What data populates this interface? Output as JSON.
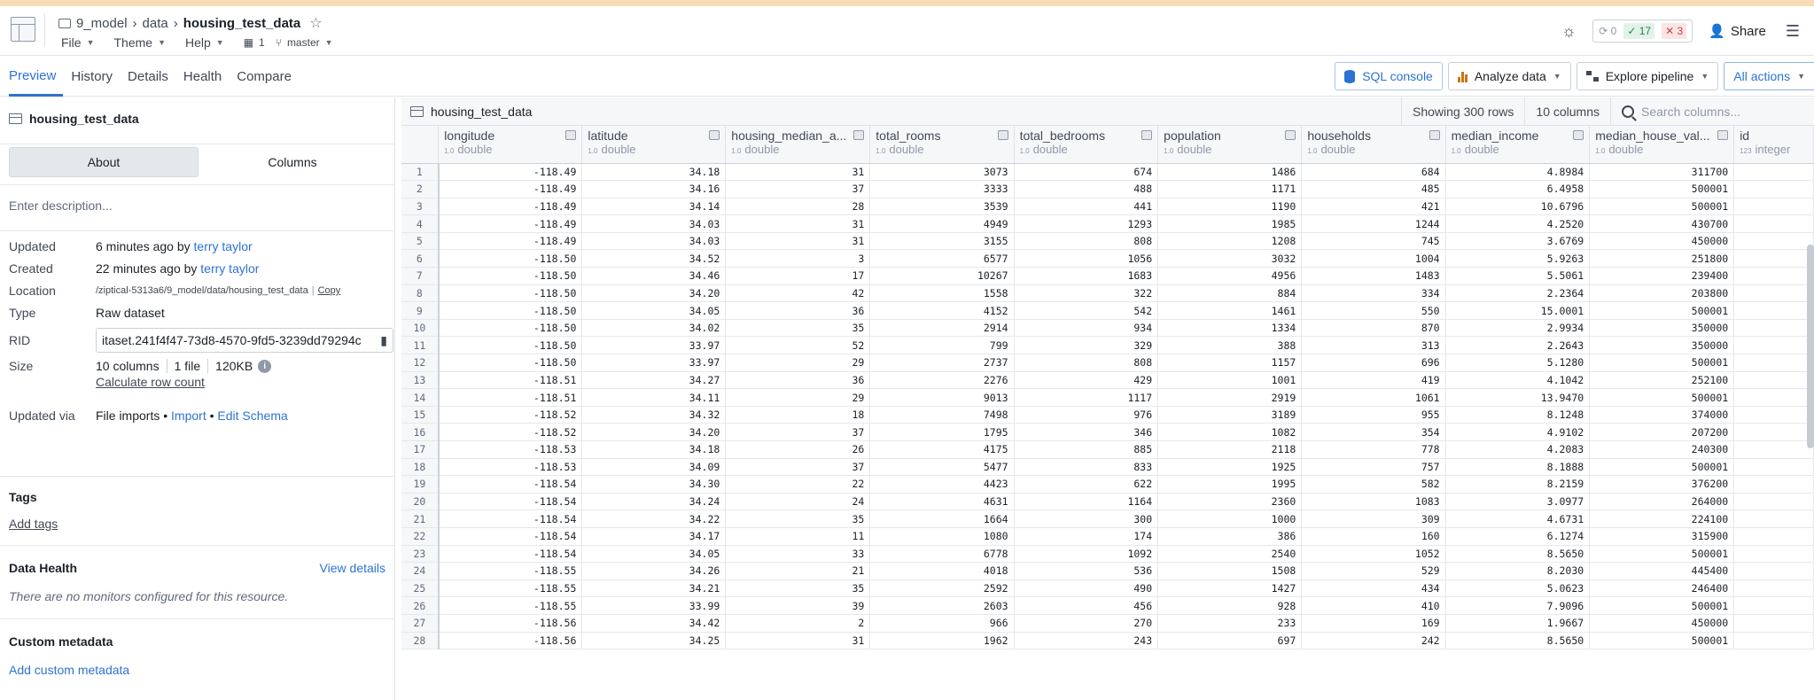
{
  "breadcrumb": {
    "parts": [
      "9_model",
      "data"
    ],
    "current": "housing_test_data"
  },
  "menus": [
    {
      "label": "File"
    },
    {
      "label": "Theme"
    },
    {
      "label": "Help"
    }
  ],
  "header": {
    "branch_count": "1",
    "branch": "master",
    "checks": {
      "pending": "0",
      "passed": "17",
      "failed": "3"
    },
    "share_label": "Share"
  },
  "tabs": [
    "Preview",
    "History",
    "Details",
    "Health",
    "Compare"
  ],
  "actions": {
    "sql": "SQL console",
    "analyze": "Analyze data",
    "explore": "Explore pipeline",
    "all": "All actions"
  },
  "left": {
    "title": "housing_test_data",
    "seg_about": "About",
    "seg_columns": "Columns",
    "description_placeholder": "Enter description...",
    "updated_label": "Updated",
    "updated_time": "6 minutes ago by",
    "updated_user": "terry taylor",
    "created_label": "Created",
    "created_time": "22 minutes ago by",
    "created_user": "terry taylor",
    "location_label": "Location",
    "location_value": "/ziptical-5313a6/9_model/data/housing_test_data",
    "copy_label": "Copy",
    "type_label": "Type",
    "type_value": "Raw dataset",
    "rid_label": "RID",
    "rid_value": "itaset.241f4f47-73d8-4570-9fd5-3239dd79294c",
    "size_label": "Size",
    "size_columns": "10 columns",
    "size_files": "1 file",
    "size_bytes": "120KB",
    "calc_rows": "Calculate row count",
    "updated_via_label": "Updated via",
    "updated_via_value": "File imports",
    "import_link": "Import",
    "edit_schema_link": "Edit Schema",
    "tags_heading": "Tags",
    "add_tags": "Add tags",
    "health_heading": "Data Health",
    "view_details": "View details",
    "health_note": "There are no monitors configured for this resource.",
    "custom_heading": "Custom metadata",
    "add_custom": "Add custom metadata"
  },
  "grid": {
    "name": "housing_test_data",
    "showing": "Showing 300 rows",
    "columns_count": "10 columns",
    "search_placeholder": "Search columns...",
    "columns": [
      {
        "name": "longitude",
        "type": "double"
      },
      {
        "name": "latitude",
        "type": "double"
      },
      {
        "name": "housing_median_a...",
        "type": "double"
      },
      {
        "name": "total_rooms",
        "type": "double"
      },
      {
        "name": "total_bedrooms",
        "type": "double"
      },
      {
        "name": "population",
        "type": "double"
      },
      {
        "name": "households",
        "type": "double"
      },
      {
        "name": "median_income",
        "type": "double"
      },
      {
        "name": "median_house_val...",
        "type": "double"
      },
      {
        "name": "id",
        "type": "integer"
      }
    ],
    "rows": [
      [
        "1",
        "-118.49",
        "34.18",
        "31",
        "3073",
        "674",
        "1486",
        "684",
        "4.8984",
        "311700"
      ],
      [
        "2",
        "-118.49",
        "34.16",
        "37",
        "3333",
        "488",
        "1171",
        "485",
        "6.4958",
        "500001"
      ],
      [
        "3",
        "-118.49",
        "34.14",
        "28",
        "3539",
        "441",
        "1190",
        "421",
        "10.6796",
        "500001"
      ],
      [
        "4",
        "-118.49",
        "34.03",
        "31",
        "4949",
        "1293",
        "1985",
        "1244",
        "4.2520",
        "430700"
      ],
      [
        "5",
        "-118.49",
        "34.03",
        "31",
        "3155",
        "808",
        "1208",
        "745",
        "3.6769",
        "450000"
      ],
      [
        "6",
        "-118.50",
        "34.52",
        "3",
        "6577",
        "1056",
        "3032",
        "1004",
        "5.9263",
        "251800"
      ],
      [
        "7",
        "-118.50",
        "34.46",
        "17",
        "10267",
        "1683",
        "4956",
        "1483",
        "5.5061",
        "239400"
      ],
      [
        "8",
        "-118.50",
        "34.20",
        "42",
        "1558",
        "322",
        "884",
        "334",
        "2.2364",
        "203800"
      ],
      [
        "9",
        "-118.50",
        "34.05",
        "36",
        "4152",
        "542",
        "1461",
        "550",
        "15.0001",
        "500001"
      ],
      [
        "10",
        "-118.50",
        "34.02",
        "35",
        "2914",
        "934",
        "1334",
        "870",
        "2.9934",
        "350000"
      ],
      [
        "11",
        "-118.50",
        "33.97",
        "52",
        "799",
        "329",
        "388",
        "313",
        "2.2643",
        "350000"
      ],
      [
        "12",
        "-118.50",
        "33.97",
        "29",
        "2737",
        "808",
        "1157",
        "696",
        "5.1280",
        "500001"
      ],
      [
        "13",
        "-118.51",
        "34.27",
        "36",
        "2276",
        "429",
        "1001",
        "419",
        "4.1042",
        "252100"
      ],
      [
        "14",
        "-118.51",
        "34.11",
        "29",
        "9013",
        "1117",
        "2919",
        "1061",
        "13.9470",
        "500001"
      ],
      [
        "15",
        "-118.52",
        "34.32",
        "18",
        "7498",
        "976",
        "3189",
        "955",
        "8.1248",
        "374000"
      ],
      [
        "16",
        "-118.52",
        "34.20",
        "37",
        "1795",
        "346",
        "1082",
        "354",
        "4.9102",
        "207200"
      ],
      [
        "17",
        "-118.53",
        "34.18",
        "26",
        "4175",
        "885",
        "2118",
        "778",
        "4.2083",
        "240300"
      ],
      [
        "18",
        "-118.53",
        "34.09",
        "37",
        "5477",
        "833",
        "1925",
        "757",
        "8.1888",
        "500001"
      ],
      [
        "19",
        "-118.54",
        "34.30",
        "22",
        "4423",
        "622",
        "1995",
        "582",
        "8.2159",
        "376200"
      ],
      [
        "20",
        "-118.54",
        "34.24",
        "24",
        "4631",
        "1164",
        "2360",
        "1083",
        "3.0977",
        "264000"
      ],
      [
        "21",
        "-118.54",
        "34.22",
        "35",
        "1664",
        "300",
        "1000",
        "309",
        "4.6731",
        "224100"
      ],
      [
        "22",
        "-118.54",
        "34.17",
        "11",
        "1080",
        "174",
        "386",
        "160",
        "6.1274",
        "315900"
      ],
      [
        "23",
        "-118.54",
        "34.05",
        "33",
        "6778",
        "1092",
        "2540",
        "1052",
        "8.5650",
        "500001"
      ],
      [
        "24",
        "-118.55",
        "34.26",
        "21",
        "4018",
        "536",
        "1508",
        "529",
        "8.2030",
        "445400"
      ],
      [
        "25",
        "-118.55",
        "34.21",
        "35",
        "2592",
        "490",
        "1427",
        "434",
        "5.0623",
        "246400"
      ],
      [
        "26",
        "-118.55",
        "33.99",
        "39",
        "2603",
        "456",
        "928",
        "410",
        "7.9096",
        "500001"
      ],
      [
        "27",
        "-118.56",
        "34.42",
        "2",
        "966",
        "270",
        "233",
        "169",
        "1.9667",
        "450000"
      ],
      [
        "28",
        "-118.56",
        "34.25",
        "31",
        "1962",
        "243",
        "697",
        "242",
        "8.5650",
        "500001"
      ]
    ]
  }
}
